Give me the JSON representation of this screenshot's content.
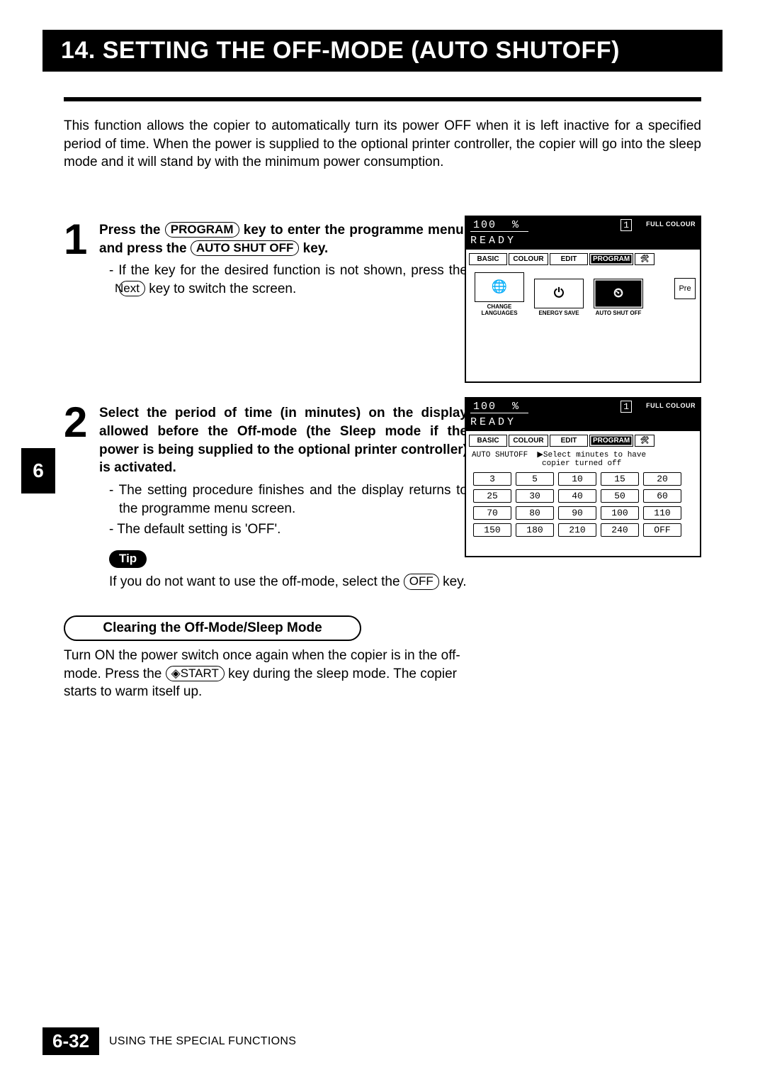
{
  "title": "14. SETTING THE OFF-MODE (AUTO SHUTOFF)",
  "intro": "This function allows the copier to automatically turn its power OFF when it is left inactive for a specified period of time. When the power is supplied to the optional printer controller, the copier will go into the sleep mode and it will stand by with the minimum power consumption.",
  "chapter_tab": "6",
  "step1": {
    "head_a": "Press the ",
    "key1": "PROGRAM",
    "head_b": " key to enter the programme menu, and  press the ",
    "key2": "AUTO SHUT OFF",
    "head_c": " key.",
    "sub1_a": "If the key for the desired function is not shown, press the ",
    "sub1_key": "Next",
    "sub1_b": " key to switch the screen."
  },
  "step2": {
    "heading": "Select the period of time (in minutes) on the display allowed before the Off-mode (the Sleep mode if the power is being supplied to the optional printer controller) is activated.",
    "sub1": "The setting procedure finishes and the display returns to the programme menu screen.",
    "sub2": "The default setting is 'OFF'."
  },
  "tip": {
    "label": "Tip",
    "text_a": "If you do not want to use the off-mode, select the ",
    "key": "OFF",
    "text_b": " key."
  },
  "callout": {
    "title": "Clearing the Off-Mode/Sleep Mode",
    "body_a": "Turn ON the power switch once again when the copier is in the off-mode.  Press the ",
    "key": "◈START",
    "body_b": " key during the sleep mode.  The copier starts to warm itself up."
  },
  "lcd": {
    "percent": "100",
    "pct_sym": "%",
    "copies": "1",
    "full_colour": "FULL COLOUR",
    "ready": "READY",
    "tabs": {
      "basic": "BASIC",
      "colour": "COLOUR",
      "edit": "EDIT",
      "program": "PROGRAM"
    },
    "icons": {
      "change_lang": "CHANGE LANGUAGES",
      "energy_save": "ENERGY SAVE",
      "auto_shutoff": "AUTO SHUT OFF",
      "pre": "Pre"
    },
    "instr_lbl": "AUTO SHUTOFF",
    "instr_txt1": "▶Select minutes to have",
    "instr_txt2": "copier turned off",
    "minutes": [
      [
        "3",
        "5",
        "10",
        "15",
        "20"
      ],
      [
        "25",
        "30",
        "40",
        "50",
        "60"
      ],
      [
        "70",
        "80",
        "90",
        "100",
        "110"
      ],
      [
        "150",
        "180",
        "210",
        "240",
        "OFF"
      ]
    ]
  },
  "footer": {
    "page": "6-32",
    "section": "USING THE SPECIAL FUNCTIONS"
  }
}
